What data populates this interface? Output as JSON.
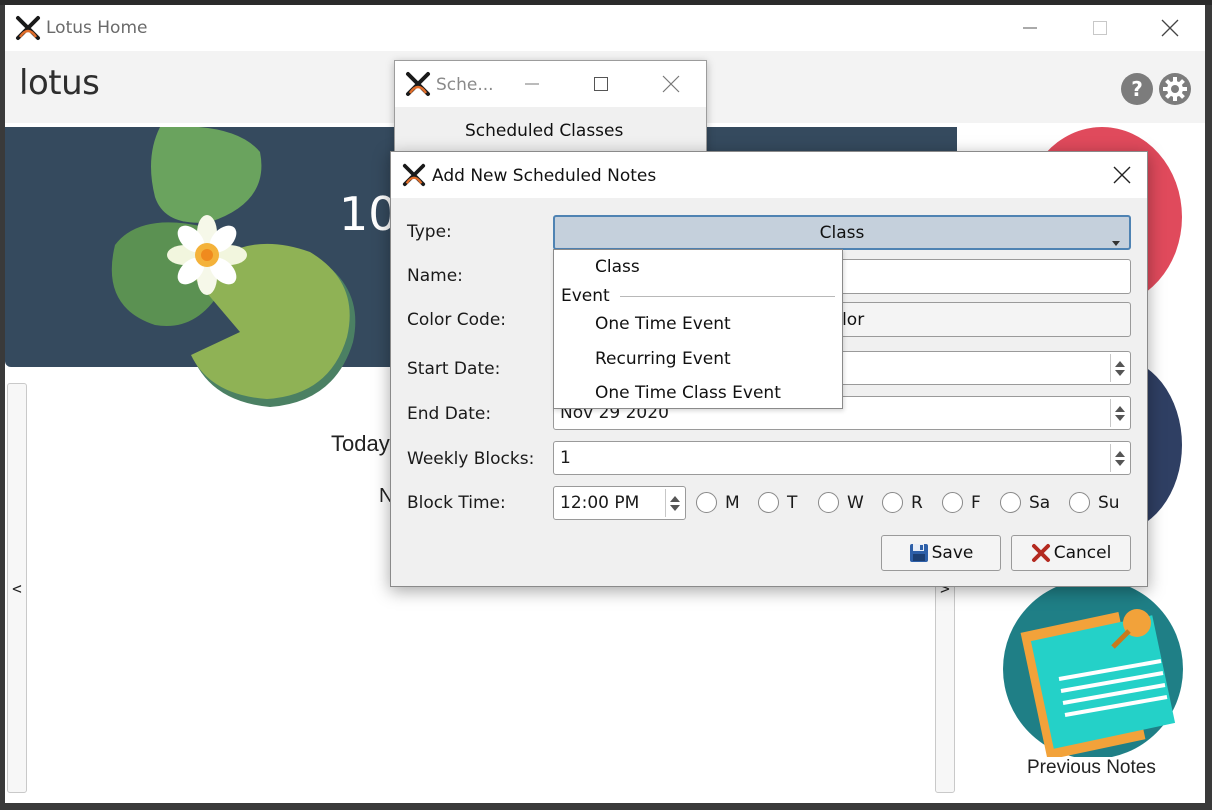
{
  "main_window": {
    "title": "Lotus Home",
    "brand": "lotus",
    "banner_number": "10",
    "today_label": "Today",
    "n_label": "N",
    "help_label": "?",
    "prev_scroll": "<",
    "next_scroll": ">",
    "previous_notes_label": "Previous Notes"
  },
  "scheduled_window": {
    "title": "Sche...",
    "heading": "Scheduled Classes"
  },
  "add_dialog": {
    "title": "Add New Scheduled Notes",
    "type_label": "Type:",
    "type_value": "Class",
    "name_label": "Name:",
    "color_label": "Color Code:",
    "color_button": "Color",
    "start_label": "Start Date:",
    "end_label": "End Date:",
    "end_value": "Nov 29 2020",
    "weekly_label": "Weekly Blocks:",
    "weekly_value": "1",
    "block_label": "Block Time:",
    "block_value": "12:00 PM",
    "days": [
      "M",
      "T",
      "W",
      "R",
      "F",
      "Sa",
      "Su"
    ],
    "save_label": "Save",
    "cancel_label": "Cancel"
  },
  "dropdown": {
    "items": [
      {
        "label": "Class",
        "kind": "option"
      },
      {
        "label": "Event",
        "kind": "group"
      },
      {
        "label": "One Time Event",
        "kind": "option"
      },
      {
        "label": "Recurring Event",
        "kind": "option"
      },
      {
        "label": "One Time Class Event",
        "kind": "option"
      }
    ]
  },
  "colors": {
    "banner": "#354a5e",
    "red_tile": "#e04a5c",
    "navy_tile": "#2f3f63",
    "teal_tile": "#1f7f86",
    "combo_focus": "#4f83b3"
  },
  "icons": [
    "lotus-app-icon",
    "minimize-icon",
    "maximize-icon",
    "close-icon",
    "help-icon",
    "gear-icon",
    "save-icon",
    "cancel-icon",
    "dropdown-arrow-icon"
  ]
}
